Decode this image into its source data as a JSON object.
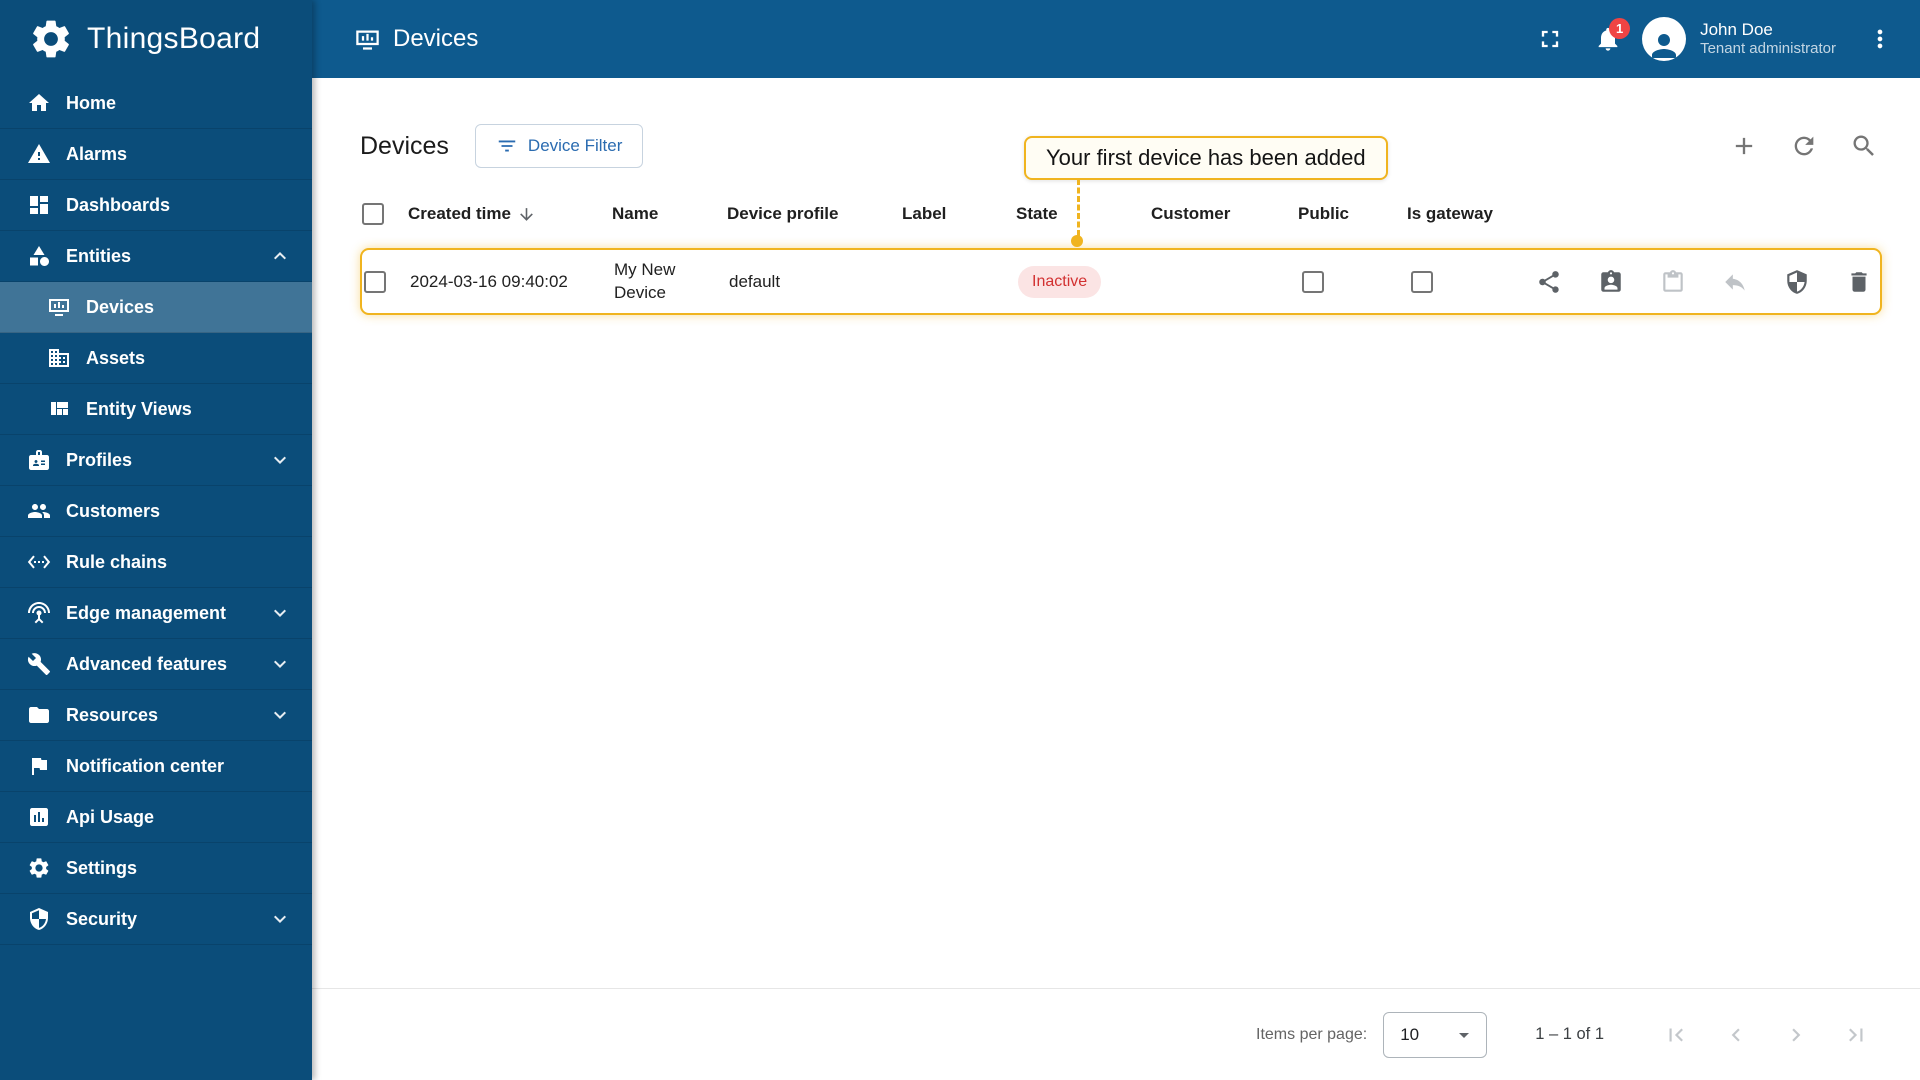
{
  "app": {
    "brand": "ThingsBoard"
  },
  "topbar": {
    "title": "Devices",
    "notification_badge": "1",
    "user": {
      "name": "John Doe",
      "role": "Tenant administrator"
    }
  },
  "sidebar": {
    "items": [
      {
        "label": "Home"
      },
      {
        "label": "Alarms"
      },
      {
        "label": "Dashboards"
      },
      {
        "label": "Entities",
        "expanded": true
      },
      {
        "label": "Devices",
        "active": true
      },
      {
        "label": "Assets"
      },
      {
        "label": "Entity Views"
      },
      {
        "label": "Profiles",
        "expandable": true
      },
      {
        "label": "Customers"
      },
      {
        "label": "Rule chains"
      },
      {
        "label": "Edge management",
        "expandable": true
      },
      {
        "label": "Advanced features",
        "expandable": true
      },
      {
        "label": "Resources",
        "expandable": true
      },
      {
        "label": "Notification center"
      },
      {
        "label": "Api Usage"
      },
      {
        "label": "Settings"
      },
      {
        "label": "Security",
        "expandable": true
      }
    ]
  },
  "content": {
    "title": "Devices",
    "filter_button_label": "Device Filter",
    "callout_text": "Your first device has been added",
    "table": {
      "columns": [
        "Created time",
        "Name",
        "Device profile",
        "Label",
        "State",
        "Customer",
        "Public",
        "Is gateway"
      ],
      "rows": [
        {
          "created_time": "2024-03-16 09:40:02",
          "name": "My New Device",
          "device_profile": "default",
          "label": "",
          "state": "Inactive",
          "customer": "",
          "public": false,
          "is_gateway": false
        }
      ]
    },
    "paginator": {
      "items_per_page_label": "Items per page:",
      "page_size": "10",
      "range_label": "1 – 1 of 1"
    }
  },
  "colors": {
    "topbar_bg": "#0e5a8e",
    "sidebar_bg": "#0b4d7a",
    "sidebar_active_bg": "#2f6d94",
    "accent_amber": "#f0b41f",
    "primary_blue": "#2a6bb0",
    "inactive_text": "#d23131",
    "inactive_bg": "#fbe4e4",
    "badge_red": "#ef4444"
  },
  "icons": [
    "thingsboard-logo-icon",
    "home-icon",
    "alarms-icon",
    "dashboards-icon",
    "entities-icon",
    "devices-icon",
    "assets-icon",
    "entity-views-icon",
    "profiles-icon",
    "customers-icon",
    "rule-chains-icon",
    "edge-management-icon",
    "advanced-features-icon",
    "resources-icon",
    "notification-center-icon",
    "api-usage-icon",
    "settings-icon",
    "security-icon",
    "chevron-up-icon",
    "chevron-down-icon",
    "fullscreen-icon",
    "notifications-bell-icon",
    "avatar-icon",
    "more-vert-icon",
    "filter-icon",
    "add-icon",
    "refresh-icon",
    "search-icon",
    "sort-desc-icon",
    "share-icon",
    "assign-customer-icon",
    "credentials-icon",
    "undo-icon",
    "shield-icon",
    "delete-icon",
    "first-page-icon",
    "prev-page-icon",
    "next-page-icon",
    "last-page-icon",
    "dropdown-arrow-icon"
  ]
}
